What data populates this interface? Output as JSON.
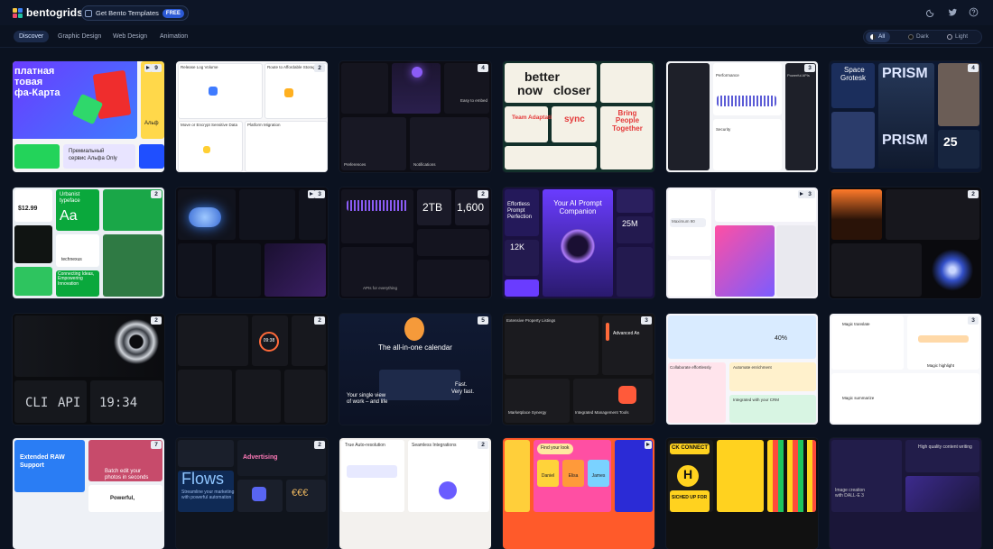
{
  "header": {
    "logo_text": "bentogrids",
    "templates_label": "Get Bento Templates",
    "templates_badge": "FREE",
    "icons": [
      "moon-icon",
      "twitter-icon",
      "help-icon"
    ]
  },
  "nav": {
    "tabs": [
      {
        "label": "Discover",
        "active": true
      },
      {
        "label": "Graphic Design",
        "active": false
      },
      {
        "label": "Web Design",
        "active": false
      },
      {
        "label": "Animation",
        "active": false
      }
    ],
    "theme": [
      {
        "label": "All",
        "active": true
      },
      {
        "label": "Dark",
        "active": false
      },
      {
        "label": "Light",
        "active": false
      }
    ]
  },
  "cards": {
    "r1c1": {
      "count": "9",
      "text1": "платная",
      "text2": "товая",
      "text3": "фа-Карта",
      "text4": "Премиальный",
      "text5": "сервис Альфа Only",
      "text6": "Альф"
    },
    "r1c2": {
      "count": "2",
      "text1": "Release Log Volume",
      "text2": "Route to Affordable Storage",
      "text3": "Move or Encrypt Sensitive Data",
      "text4": "Platform Migration"
    },
    "r1c3": {
      "count": "4",
      "text1": "Preferences",
      "text2": "Notifications",
      "text3": "Easy to embed"
    },
    "r1c4": {
      "text1": "better",
      "text2": "now",
      "text3": "closer",
      "text4": "Team Adaptation",
      "text5": "sync",
      "text6": "Bring People Together"
    },
    "r1c5": {
      "count": "3",
      "text1": "Performance",
      "text2": "Powerful APIs",
      "text3": "Security"
    },
    "r1c6": {
      "count": "4",
      "text1": "Space",
      "text2": "Grotesk",
      "text3": "PRISM",
      "text4": "PRISM",
      "text5": "25"
    },
    "r2c1": {
      "count": "2",
      "text1": "Urbanist",
      "text2": "typeface",
      "text3": "Aa",
      "text4": "$12.99",
      "text5": "technexus",
      "text6": "Connecting Ideas, Empowering Innovation"
    },
    "r2c2": {
      "count": "3"
    },
    "r2c3": {
      "count": "2",
      "text1": "2TB",
      "text2": "1,600",
      "text3": "APIs for everything"
    },
    "r2c4": {
      "text1": "Effortless",
      "text2": "Prompt",
      "text3": "Perfection",
      "text4": "Your AI Prompt",
      "text5": "Companion",
      "text6": "25M",
      "text7": "12K"
    },
    "r2c5": {
      "count": "3",
      "text1": "Maximum 90"
    },
    "r2c6": {
      "count": "2"
    },
    "r3c1": {
      "count": "2",
      "text1": "CLI",
      "text2": "API",
      "text3": "19:34"
    },
    "r3c2": {
      "count": "2",
      "text1": "09:38"
    },
    "r3c3": {
      "count": "5",
      "text1": "The all-in-one calendar",
      "text2": "Your single view",
      "text3": "of work – and life",
      "text4": "Fast.",
      "text5": "Very fast."
    },
    "r3c4": {
      "count": "3",
      "text1": "Extensive Property Listings",
      "text2": "Advanced An",
      "text3": "Marketplace Synergy",
      "text4": "Integrated Management Tools"
    },
    "r3c5": {
      "text1": "40%",
      "text2": "Collaborate effortlessly",
      "text3": "Automate enrichment",
      "text4": "Integrated with your CRM"
    },
    "r3c6": {
      "count": "3",
      "text1": "Magic translate",
      "text2": "Magic highlight",
      "text3": "Magic summarize"
    },
    "r4c1": {
      "count": "7",
      "text1": "Extended RAW",
      "text2": "Support",
      "text3": "Batch edit your",
      "text4": "photos in seconds",
      "text5": "Powerful,"
    },
    "r4c2": {
      "count": "2",
      "text1": "Advertising",
      "text2": "Flows",
      "text3": "Streamline your marketing",
      "text4": "with powerful automation",
      "text5": "€€€"
    },
    "r4c3": {
      "count": "2",
      "text1": "True Auto-resolution",
      "text2": "Seamless Integrations"
    },
    "r4c4": {
      "text1": "Find your look",
      "text2": "Daniel",
      "text3": "Elisa",
      "text4": "James"
    },
    "r4c5": {
      "text1": "CK CONNECT",
      "text2": "H",
      "text3": "SICHED UP FOR"
    },
    "r4c6": {
      "text1": "High quality content writing",
      "text2": "Image creation",
      "text3": "with DALL-E 3"
    }
  }
}
